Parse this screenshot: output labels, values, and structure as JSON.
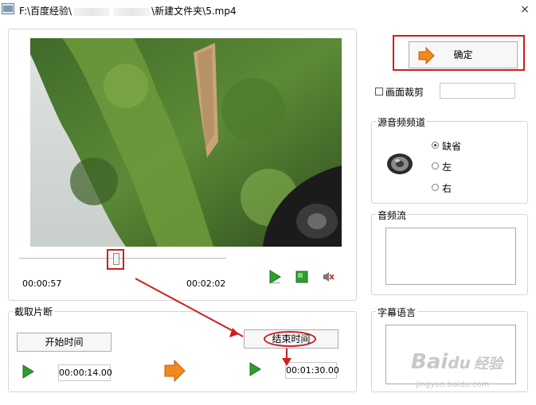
{
  "window": {
    "title_path": "F:\\百度经验\\",
    "title_folder": "\\新建文件夹\\5.mp4",
    "close": "×"
  },
  "player": {
    "current_time": "00:00:57",
    "total_time": "00:02:02",
    "position_fraction": 0.47
  },
  "clip": {
    "group_title": "截取片断",
    "start_button": "开始时间",
    "end_button": "结束时间",
    "start_time": "00:00:14.00",
    "end_time": "00:01:30.00"
  },
  "side": {
    "confirm_button": "确定",
    "crop_label": "画面裁剪",
    "crop_checked": false,
    "audio_channel_title": "源音频频道",
    "channel_options": [
      "缺省",
      "左",
      "右"
    ],
    "selected_channel": "缺省",
    "audio_stream_title": "音频流",
    "subtitle_title": "字幕语言"
  },
  "watermark": {
    "text": "Bai",
    "text2": "经验",
    "url": "jingyan.baidu.com"
  },
  "colors": {
    "highlight_red": "#cc1f1f",
    "play_green": "#2e9e2e",
    "arrow_orange": "#f08a1c"
  },
  "icons": [
    "app-icon",
    "play-icon",
    "stop-icon",
    "mute-icon",
    "speaker-icon",
    "arrow-right-icon",
    "close-icon"
  ]
}
